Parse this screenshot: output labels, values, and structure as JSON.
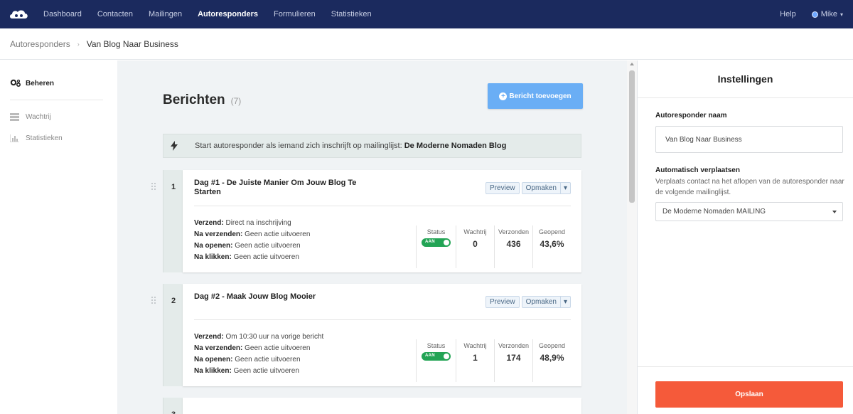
{
  "nav": {
    "items": [
      {
        "label": "Dashboard",
        "active": false
      },
      {
        "label": "Contacten",
        "active": false
      },
      {
        "label": "Mailingen",
        "active": false
      },
      {
        "label": "Autoresponders",
        "active": true
      },
      {
        "label": "Formulieren",
        "active": false
      },
      {
        "label": "Statistieken",
        "active": false
      }
    ],
    "help": "Help",
    "user": "Mike"
  },
  "breadcrumb": {
    "parent": "Autoresponders",
    "current": "Van Blog Naar Business"
  },
  "sidebar": {
    "items": [
      {
        "label": "Beheren",
        "icon": "gears-icon"
      },
      {
        "label": "Wachtrij",
        "icon": "list-icon"
      },
      {
        "label": "Statistieken",
        "icon": "bar-chart-icon"
      }
    ]
  },
  "main": {
    "title": "Berichten",
    "count": "(7)",
    "add_button": "Bericht toevoegen",
    "trigger": {
      "text": "Start autoresponder als iemand zich inschrijft op mailinglijst:",
      "list": "De Moderne Nomaden Blog"
    },
    "labels": {
      "verzend": "Verzend:",
      "na_verzenden": "Na verzenden:",
      "na_openen": "Na openen:",
      "na_klikken": "Na klikken:",
      "preview": "Preview",
      "opmaken": "Opmaken",
      "status": "Status",
      "wachtrij": "Wachtrij",
      "verzonden": "Verzonden",
      "geopend": "Geopend",
      "toggle": "AAN"
    },
    "messages": [
      {
        "num": "1",
        "title": "Dag #1 - De Juiste Manier Om Jouw Blog Te Starten",
        "verzend": "Direct na inschrijving",
        "na_verzenden": "Geen actie uitvoeren",
        "na_openen": "Geen actie uitvoeren",
        "na_klikken": "Geen actie uitvoeren",
        "wachtrij": "0",
        "verzonden": "436",
        "geopend": "43,6%"
      },
      {
        "num": "2",
        "title": "Dag #2 - Maak Jouw Blog Mooier",
        "verzend": "Om 10:30 uur na vorige bericht",
        "na_verzenden": "Geen actie uitvoeren",
        "na_openen": "Geen actie uitvoeren",
        "na_klikken": "Geen actie uitvoeren",
        "wachtrij": "1",
        "verzonden": "174",
        "geopend": "48,9%"
      }
    ],
    "partial_num": "3"
  },
  "settings": {
    "title": "Instellingen",
    "name_label": "Autoresponder naam",
    "name_value": "Van Blog Naar Business",
    "move_label": "Automatisch verplaatsen",
    "move_help": "Verplaats contact na het aflopen van de autoresponder naar de volgende mailinglijst.",
    "move_select": "De Moderne Nomaden MAILING",
    "save_button": "Opslaan"
  },
  "colors": {
    "nav_bg": "#1b2a5e",
    "accent_blue": "#6aaef5",
    "status_green": "#23a455",
    "save_orange": "#f55a3a"
  }
}
